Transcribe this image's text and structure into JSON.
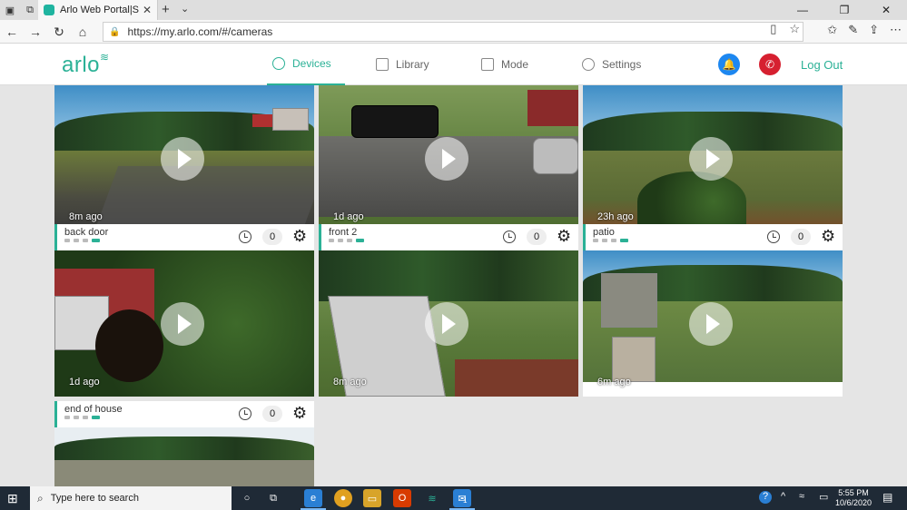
{
  "browser": {
    "tab_title": "Arlo Web Portal|Smart H",
    "url": "https://my.arlo.com/#/cameras",
    "accent": "#f7f7f7"
  },
  "app": {
    "brand_color": "#2bb196",
    "logo": "arlo",
    "nav": [
      {
        "label": "Devices",
        "icon": "devices-icon",
        "active": true
      },
      {
        "label": "Library",
        "icon": "library-grid-icon",
        "active": false
      },
      {
        "label": "Mode",
        "icon": "mode-icon",
        "active": false
      },
      {
        "label": "Settings",
        "icon": "gear-icon",
        "active": false
      }
    ],
    "logout": "Log Out"
  },
  "cameras": [
    {
      "name": "",
      "ago": "8m ago",
      "count": "0"
    },
    {
      "name": "",
      "ago": "1d ago",
      "count": "0"
    },
    {
      "name": "",
      "ago": "23h ago",
      "count": "0"
    },
    {
      "name": "back door",
      "ago": "1d ago",
      "count": "0"
    },
    {
      "name": "front 2",
      "ago": "8m ago",
      "count": "0"
    },
    {
      "name": "patio",
      "ago": "6m ago",
      "count": "0"
    },
    {
      "name": "end of house",
      "ago": "",
      "count": "0"
    }
  ],
  "taskbar": {
    "search_placeholder": "Type here to search",
    "time": "5:55 PM",
    "date": "10/6/2020",
    "mail_badge": "1"
  }
}
